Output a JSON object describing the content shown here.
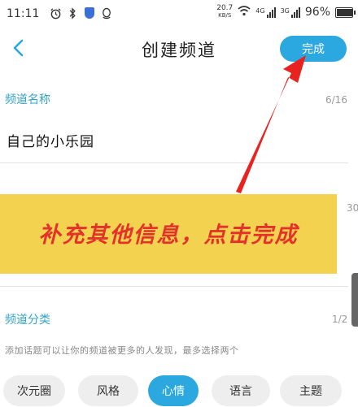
{
  "status_bar": {
    "time": "11:11",
    "speed_value": "20.7",
    "speed_unit": "KB/S",
    "net1": "4G",
    "net2": "3G",
    "battery_percent": "96%",
    "battery_level": 0.96,
    "icons": [
      "alarm-icon",
      "bluetooth-icon",
      "shield-app-icon",
      "qq-icon",
      "wifi-icon",
      "signal-icon"
    ]
  },
  "nav": {
    "title": "创建频道",
    "done_label": "完成",
    "back_icon": "chevron-left-icon"
  },
  "channel_name": {
    "label": "频道名称",
    "counter": "6/16",
    "value": "自己的小乐园"
  },
  "banner": {
    "text": "补充其他信息，点击完成"
  },
  "side_counter": "30",
  "category": {
    "label": "频道分类",
    "counter": "1/2",
    "hint": "添加话题可以让你的频道被更多的人发现，最多选择两个",
    "tags": [
      {
        "label": "次元圈",
        "selected": false
      },
      {
        "label": "风格",
        "selected": false
      },
      {
        "label": "心情",
        "selected": true
      },
      {
        "label": "语言",
        "selected": false
      },
      {
        "label": "主题",
        "selected": false
      }
    ]
  },
  "colors": {
    "accent": "#2aa8df",
    "label": "#33a4c9",
    "banner_bg": "#f3d24f",
    "banner_text": "#e4322b",
    "arrow": "#e8231f"
  }
}
